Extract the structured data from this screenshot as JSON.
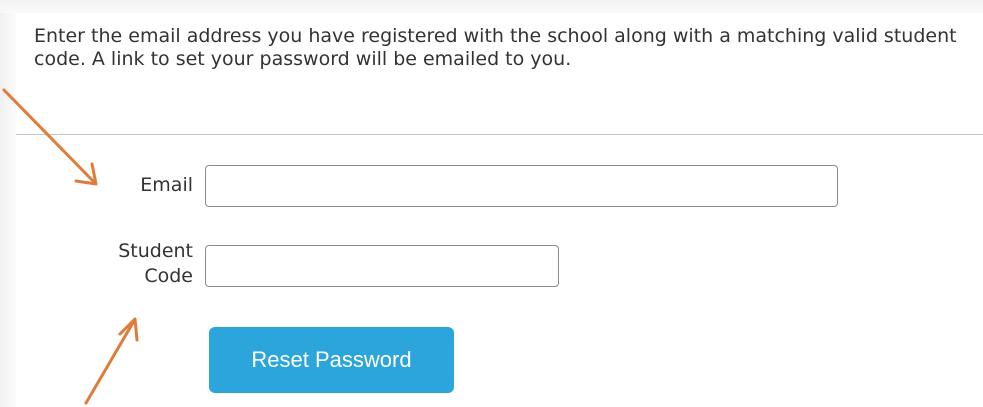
{
  "form": {
    "instructions": "Enter the email address you have registered with the school along with a matching valid student code. A link to set your password will be emailed to you.",
    "email_label": "Email",
    "email_value": "",
    "student_code_label_line1": "Student",
    "student_code_label_line2": "Code",
    "student_code_value": "",
    "submit_label": "Reset Password"
  },
  "colors": {
    "button_background": "#2ca4dc",
    "annotation_arrow": "#e07b39",
    "text": "#333333"
  }
}
